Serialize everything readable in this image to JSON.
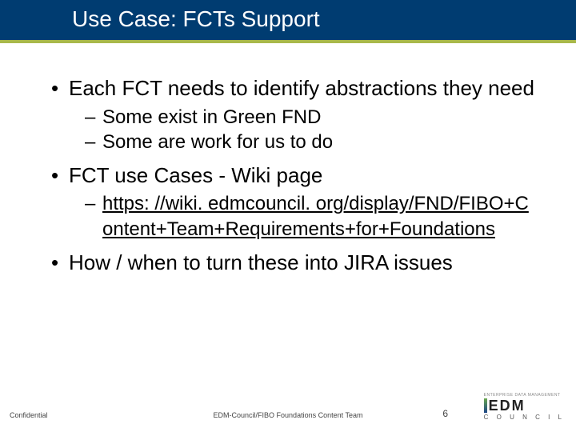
{
  "title": "Use Case: FCTs Support",
  "bullets": [
    {
      "text": "Each FCT needs to identify abstractions they need",
      "sub": [
        "Some exist in Green FND",
        "Some are work for us to do"
      ]
    },
    {
      "text": "FCT use Cases - Wiki page",
      "sub_link": "https: //wiki. edmcouncil. org/display/FND/FIBO+Content+Team+Requirements+for+Foundations"
    },
    {
      "text": "How / when to turn these into JIRA issues"
    }
  ],
  "footer": {
    "confidential": "Confidential",
    "team": "EDM-Council/FIBO Foundations Content Team",
    "page": "6",
    "logo_tag": "ENTERPRISE DATA MANAGEMENT",
    "logo_main": "EDM",
    "logo_sub": "C O U N C I L"
  }
}
